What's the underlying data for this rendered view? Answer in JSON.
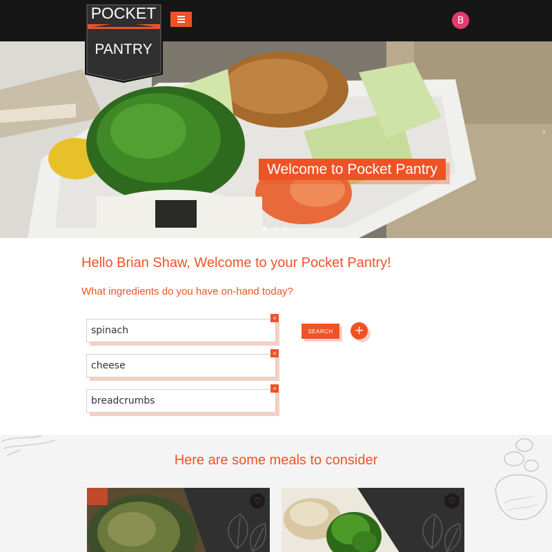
{
  "brand": {
    "logo_top": "POCKET",
    "logo_bottom": "PANTRY"
  },
  "nav": {
    "menu_icon": "hamburger-icon",
    "avatar_initial": "B",
    "avatar_color": "#e8396e"
  },
  "hero": {
    "title": "Welcome to Pocket Pantry",
    "next_icon": "›",
    "slide_count": 3,
    "active_slide": 1
  },
  "main": {
    "greeting": "Hello Brian Shaw, Welcome to your Pocket Pantry!",
    "question": "What ingredients do you have on-hand today?",
    "ingredients": [
      {
        "value": "spinach"
      },
      {
        "value": "cheese"
      },
      {
        "value": "breadcrumbs"
      }
    ],
    "remove_icon": "×",
    "search_label": "SEARCH",
    "add_icon": "+"
  },
  "meals": {
    "title": "Here are some meals to consider",
    "favorite_icon": "♡"
  },
  "colors": {
    "accent": "#ee5325",
    "navbar": "#161616",
    "meals_bg": "#f4f4f4",
    "card_dark": "#303030"
  }
}
